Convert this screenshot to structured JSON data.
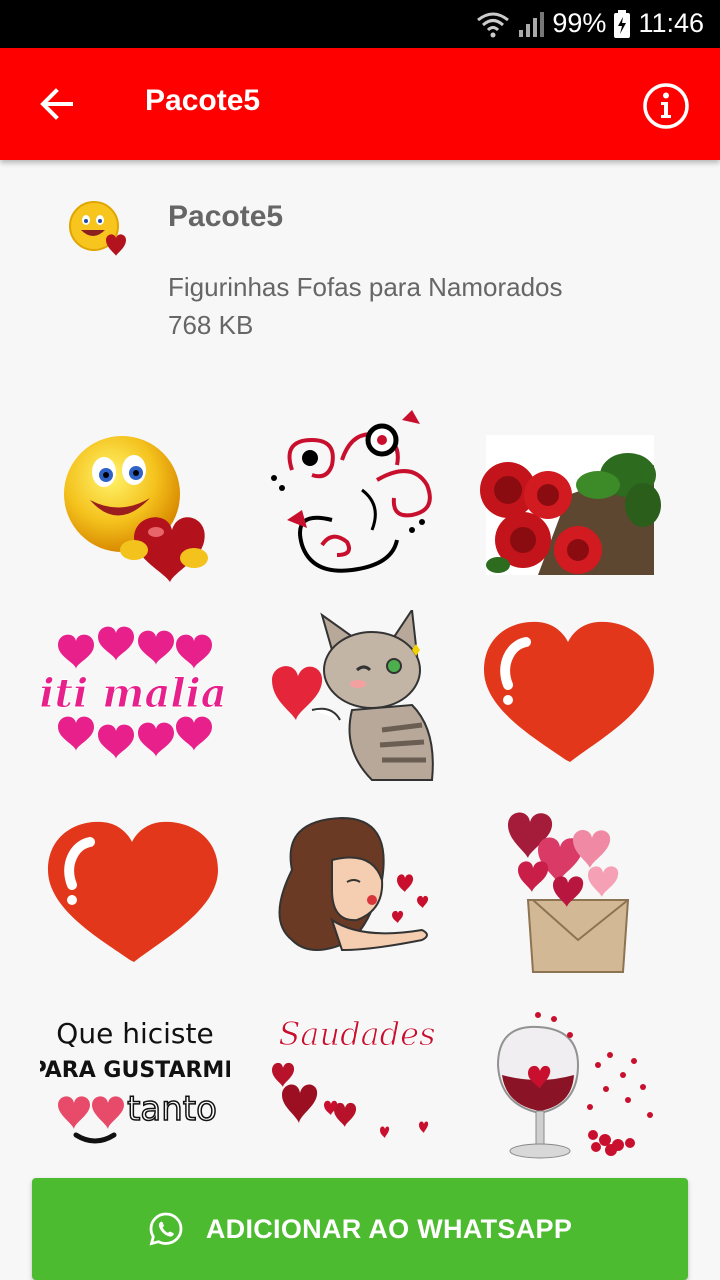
{
  "status_bar": {
    "battery": "99%",
    "time": "11:46",
    "icons": [
      "wifi-icon",
      "signal-icon",
      "battery-charging-icon"
    ]
  },
  "app_bar": {
    "title": "Pacote5",
    "back_icon": "arrow-back-icon",
    "info_icon": "info-icon",
    "color": "#ff0000"
  },
  "pack": {
    "name": "Pacote5",
    "description": "Figurinhas Fofas para Namorados",
    "size": "768 KB"
  },
  "stickers": [
    {
      "name": "emoji-heart-sticker",
      "text": ""
    },
    {
      "name": "ornament-swirl-sticker",
      "text": ""
    },
    {
      "name": "red-roses-sticker",
      "text": ""
    },
    {
      "name": "iti-malia-sticker",
      "text": "iti malia"
    },
    {
      "name": "cat-heart-sticker",
      "text": ""
    },
    {
      "name": "red-heart-sticker",
      "text": ""
    },
    {
      "name": "red-heart-sticker-2",
      "text": ""
    },
    {
      "name": "girl-kiss-sticker",
      "text": ""
    },
    {
      "name": "hearts-box-sticker",
      "text": ""
    },
    {
      "name": "que-hiciste-sticker",
      "lines": [
        "Que hiciste",
        "PARA GUSTARME",
        "tanto"
      ]
    },
    {
      "name": "saudades-sticker",
      "text": "Saudades"
    },
    {
      "name": "wine-glass-hearts-sticker",
      "text": ""
    }
  ],
  "add_button": {
    "label": "ADICIONAR AO WHATSAPP",
    "icon": "whatsapp-icon",
    "color": "#4cbb2f"
  }
}
